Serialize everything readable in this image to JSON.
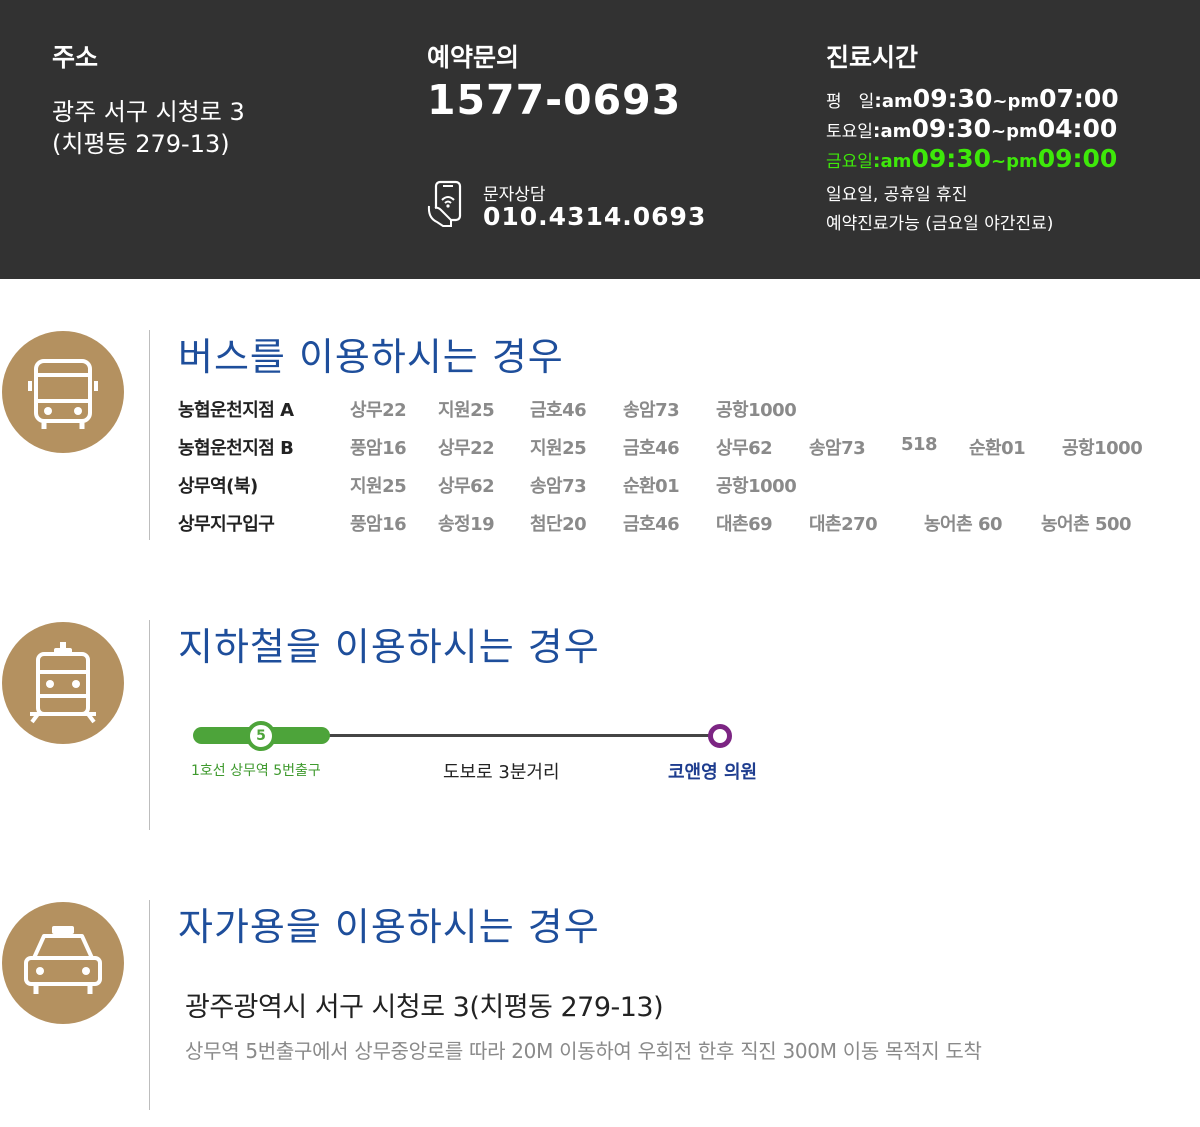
{
  "header": {
    "address": {
      "title": "주소",
      "line1": "광주 서구 시청로 3",
      "line2": "(치평동 279-13)"
    },
    "reservation": {
      "title": "예약문의",
      "phone": "1577-0693",
      "sms_label": "문자상담",
      "sms_number": "010.4314.0693",
      "sms_icon": "phone-message-icon"
    },
    "hours": {
      "title": "진료시간",
      "rows": [
        {
          "day": "평　일",
          "colon": ":",
          "am": "am ",
          "start": "09:30",
          "tilde": "~",
          "pm": "pm ",
          "end": "07:00"
        },
        {
          "day": "토요일",
          "colon": ":",
          "am": "am ",
          "start": "09:30",
          "tilde": "~",
          "pm": "pm ",
          "end": "04:00"
        },
        {
          "day": "금요일",
          "colon": ":",
          "am": "am ",
          "start": "09:30",
          "tilde": "~",
          "pm": "pm ",
          "end": "09:00"
        }
      ],
      "closed_note": "일요일, 공휴일 휴진",
      "reservation_note": "예약진료가능 (금요일 야간진료)",
      "highlight_color": "#3ee80a"
    }
  },
  "bus": {
    "title": "버스를 이용하시는 경우",
    "icon": "bus-icon",
    "stops": [
      {
        "name": "농협운천지점 A",
        "routes": [
          "상무22",
          "지원25",
          "금호46",
          "송암73",
          "공항1000"
        ]
      },
      {
        "name": "농협운천지점 B",
        "routes": [
          "풍암16",
          "상무22",
          "지원25",
          "금호46",
          "상무62",
          "송암73",
          "518",
          "순환01",
          "공항1000"
        ]
      },
      {
        "name": "상무역(북)",
        "routes": [
          "지원25",
          "상무62",
          "송암73",
          "순환01",
          "공항1000"
        ]
      },
      {
        "name": "상무지구입구",
        "routes": [
          "풍암16",
          "송정19",
          "첨단20",
          "금호46",
          "대촌69",
          "대촌270",
          "농어촌 60",
          "농어촌 500"
        ]
      }
    ]
  },
  "subway": {
    "title": "지하철을 이용하시는 경우",
    "icon": "subway-icon",
    "line_number": "5",
    "start_label": "1호선 상무역 5번출구",
    "walk_label": "도보로 3분거리",
    "dest_label": "코앤영 의원",
    "line_color": "#4da43a",
    "dest_color": "#7c2583"
  },
  "car": {
    "title": "자가용을 이용하시는 경우",
    "icon": "taxi-icon",
    "address": "광주광역시 서구 시청로 3(치평동 279-13)",
    "directions": "상무역 5번출구에서 상무중앙로를 따라 20M 이동하여 우회전 한후 직진 300M 이동  목적지 도착"
  },
  "colors": {
    "header_bg": "#323232",
    "icon_circle": "#b49160",
    "section_title": "#1e4e9b"
  }
}
